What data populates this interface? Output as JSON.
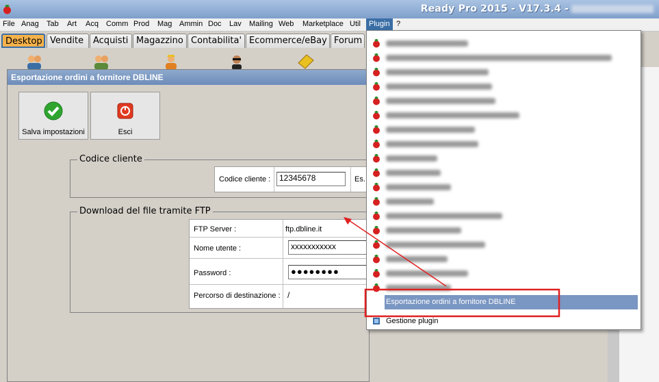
{
  "window": {
    "title": "Ready Pro 2015 - V17.3.4 -"
  },
  "menu": [
    "File",
    "Anag",
    "Tab",
    "Art",
    "Acq",
    "Comm",
    "Prod",
    "Mag",
    "Ammin",
    "Doc",
    "Lav",
    "Mailing",
    "Web",
    "Marketplace",
    "Util",
    "Plugin",
    "?"
  ],
  "tabs": [
    "Desktop",
    "Vendite",
    "Acquisti",
    "Magazzino",
    "Contabilita'",
    "Ecommerce/eBay",
    "Forum"
  ],
  "dialog": {
    "title": "Esportazione ordini a fornitore DBLINE",
    "save_label": "Salva impostazioni",
    "exit_label": "Esci",
    "group_cliente": "Codice cliente",
    "codice_label": "Codice cliente :",
    "codice_value": "12345678",
    "es_label": "Es.",
    "group_ftp": "Download del file tramite FTP",
    "ftp_server_label": "FTP Server :",
    "ftp_server_value": "ftp.dbline.it",
    "user_label": "Nome utente :",
    "user_value": "xxxxxxxxxxx",
    "password_label": "Password :",
    "password_value": "●●●●●●●●",
    "path_label": "Percorso di destinazione :",
    "path_value": "/"
  },
  "plugin_menu": {
    "selected": "Esportazione ordini a fornitore DBLINE",
    "manage": "Gestione plugin"
  },
  "colors": {
    "accent": "#3a6ea5",
    "highlight_box": "#e02020",
    "active_tab": "#f6b24a"
  }
}
